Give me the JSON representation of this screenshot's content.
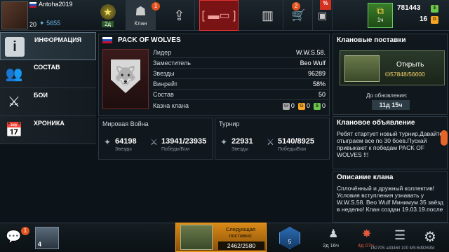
{
  "player": {
    "name": "Antoha2019",
    "level": "20",
    "rating": "5655"
  },
  "topnav": {
    "rank_label": "2д",
    "clan_label": "Клан",
    "clan_badge": "1",
    "shop_badge": "2",
    "sale_badge": "%"
  },
  "resources": {
    "gold": "781443",
    "boost_time": "1ч",
    "gems": "16"
  },
  "sidebar": {
    "items": [
      {
        "label": "ИНФОРМАЦИЯ",
        "icon": "info-icon"
      },
      {
        "label": "СОСТАВ",
        "icon": "members-icon"
      },
      {
        "label": "БОИ",
        "icon": "crossed-swords-icon"
      },
      {
        "label": "ХРОНИКА",
        "icon": "calendar-icon"
      }
    ]
  },
  "clan": {
    "name": "PACK OF WOLVES",
    "rows": [
      {
        "k": "Лидер",
        "v": "W.W.S.58."
      },
      {
        "k": "Заместитель",
        "v": "Beo Wulf"
      },
      {
        "k": "Звезды",
        "v": "96289"
      },
      {
        "k": "Винрейт",
        "v": "58%"
      },
      {
        "k": "Состав",
        "v": "50"
      },
      {
        "k": "Казна клана",
        "v": ""
      }
    ],
    "treasury": [
      "0",
      "0",
      "0"
    ]
  },
  "world_war": {
    "title": "Мировая Война",
    "stars": "64198",
    "stars_label": "Звезды",
    "wins": "13941/23935",
    "wins_label": "Победы/Бои"
  },
  "tournament": {
    "title": "Турнир",
    "stars": "22931",
    "stars_label": "Звезды",
    "wins": "5140/8925",
    "wins_label": "Победы/Бои"
  },
  "supplies": {
    "title": "Клановые поставки",
    "open_label": "Открыть",
    "progress": "57848/56600",
    "update_label": "До обновления:",
    "update_time": "11д 15ч"
  },
  "announcement": {
    "title": "Клановое объявление",
    "text": "Ребят стартует новый турнир.Давайте отыграем все по 30 боев.Пускай привыкают к победам PACK OF WOLVES !!!"
  },
  "description": {
    "title": "Описание клана",
    "text": "Сплочённый и дружный коллектив! Условия вступления узнавать у W.W.S.58. Beo Wulf Минимум 35 звёзд в неделю! Клан создан 19.03.19.после"
  },
  "bottom": {
    "chat_badge": "1",
    "crate_count": "4",
    "next_label": "Следующая поставка:",
    "next_value": "2462/2580",
    "rank_num": "5",
    "timer1": "2д 16ч",
    "timer2": "4д 07ч",
    "debug": "16270S a33460 100 MS:6d9263fd"
  },
  "colors": {
    "accent": "#f6a623",
    "active_red": "#7a1414",
    "panel_border": "#2c3a44"
  }
}
